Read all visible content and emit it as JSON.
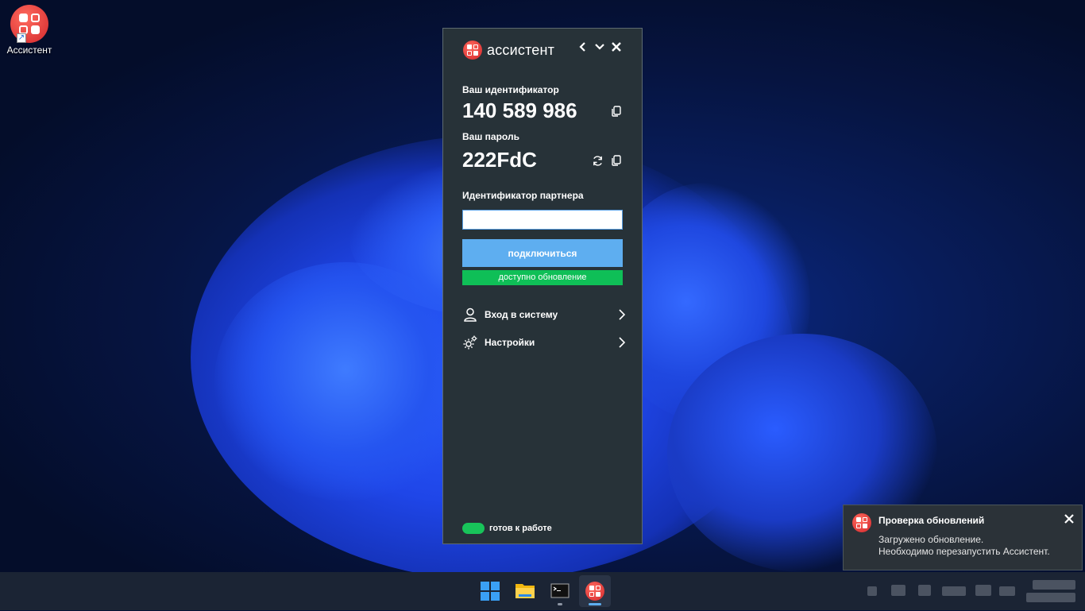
{
  "desktop": {
    "icon_label": "Ассистент"
  },
  "app": {
    "brand": "ассистент",
    "id_label": "Ваш идентификатор",
    "id_value": "140 589 986",
    "password_label": "Ваш пароль",
    "password_value": "222FdC",
    "partner_label": "Идентификатор партнера",
    "partner_input_value": "",
    "connect_button": "подключиться",
    "update_badge": "доступно обновление",
    "menu": [
      {
        "label": "Вход в систему",
        "icon": "user-icon"
      },
      {
        "label": "Настройки",
        "icon": "gear-icon"
      }
    ],
    "status_text": "готов к работе",
    "colors": {
      "window_bg": "#273238",
      "accent": "#5eaef0",
      "update_green": "#0fbf57",
      "status_green": "#18c45a",
      "brand_red": "#e0312f"
    }
  },
  "notification": {
    "title": "Проверка обновлений",
    "line1": "Загружено обновление.",
    "line2": "Необходимо перезапустить Ассистент."
  },
  "taskbar": {
    "items": [
      {
        "name": "start-icon"
      },
      {
        "name": "file-explorer-icon"
      },
      {
        "name": "terminal-icon"
      },
      {
        "name": "assistant-icon"
      }
    ]
  }
}
